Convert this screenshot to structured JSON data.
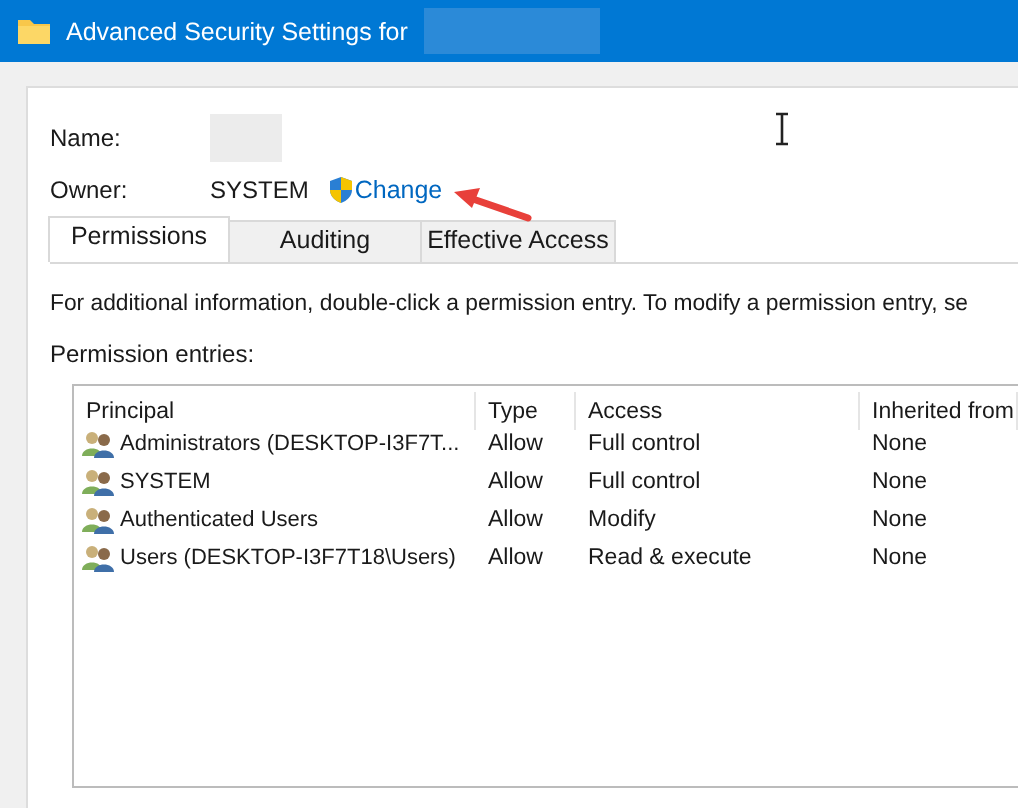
{
  "window": {
    "title": "Advanced Security Settings for"
  },
  "name_label": "Name:",
  "owner": {
    "label": "Owner:",
    "value": "SYSTEM",
    "change_link": "Change"
  },
  "tabs": [
    {
      "label": "Permissions",
      "selected": true
    },
    {
      "label": "Auditing",
      "selected": false
    },
    {
      "label": "Effective Access",
      "selected": false
    }
  ],
  "info_text": "For additional information, double-click a permission entry. To modify a permission entry, se",
  "entries_label": "Permission entries:",
  "table": {
    "columns": [
      "Principal",
      "Type",
      "Access",
      "Inherited from"
    ],
    "rows": [
      [
        "Administrators (DESKTOP-I3F7T...",
        "Allow",
        "Full control",
        "None"
      ],
      [
        "SYSTEM",
        "Allow",
        "Full control",
        "None"
      ],
      [
        "Authenticated Users",
        "Allow",
        "Modify",
        "None"
      ],
      [
        "Users (DESKTOP-I3F7T18\\Users)",
        "Allow",
        "Read & execute",
        "None"
      ]
    ]
  }
}
